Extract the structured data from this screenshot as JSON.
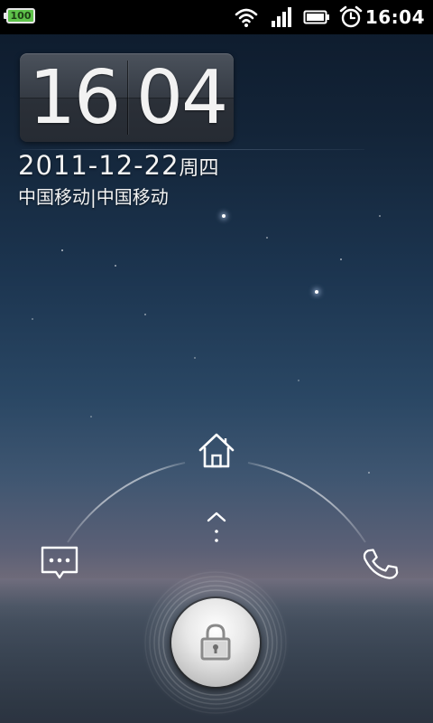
{
  "status_bar": {
    "battery_level": "100",
    "time": "16:04",
    "icons": [
      "battery-icon",
      "wifi-icon",
      "signal-icon",
      "battery-full-icon",
      "alarm-icon"
    ]
  },
  "lockscreen": {
    "clock_hour": "16",
    "clock_minute": "04",
    "date": "2011-12-22",
    "weekday": "周四",
    "carrier": "中国移动|中国移动"
  },
  "unlock_targets": {
    "home": "home-icon",
    "messages": "message-icon",
    "phone": "phone-icon",
    "lock": "lock-icon",
    "hint": "swipe-up-hint-icon"
  },
  "colors": {
    "battery_green": "#5ec24a",
    "sky_top": "#0d1a2b",
    "sky_mid": "#2a4764",
    "horizon": "#6e6a79"
  }
}
